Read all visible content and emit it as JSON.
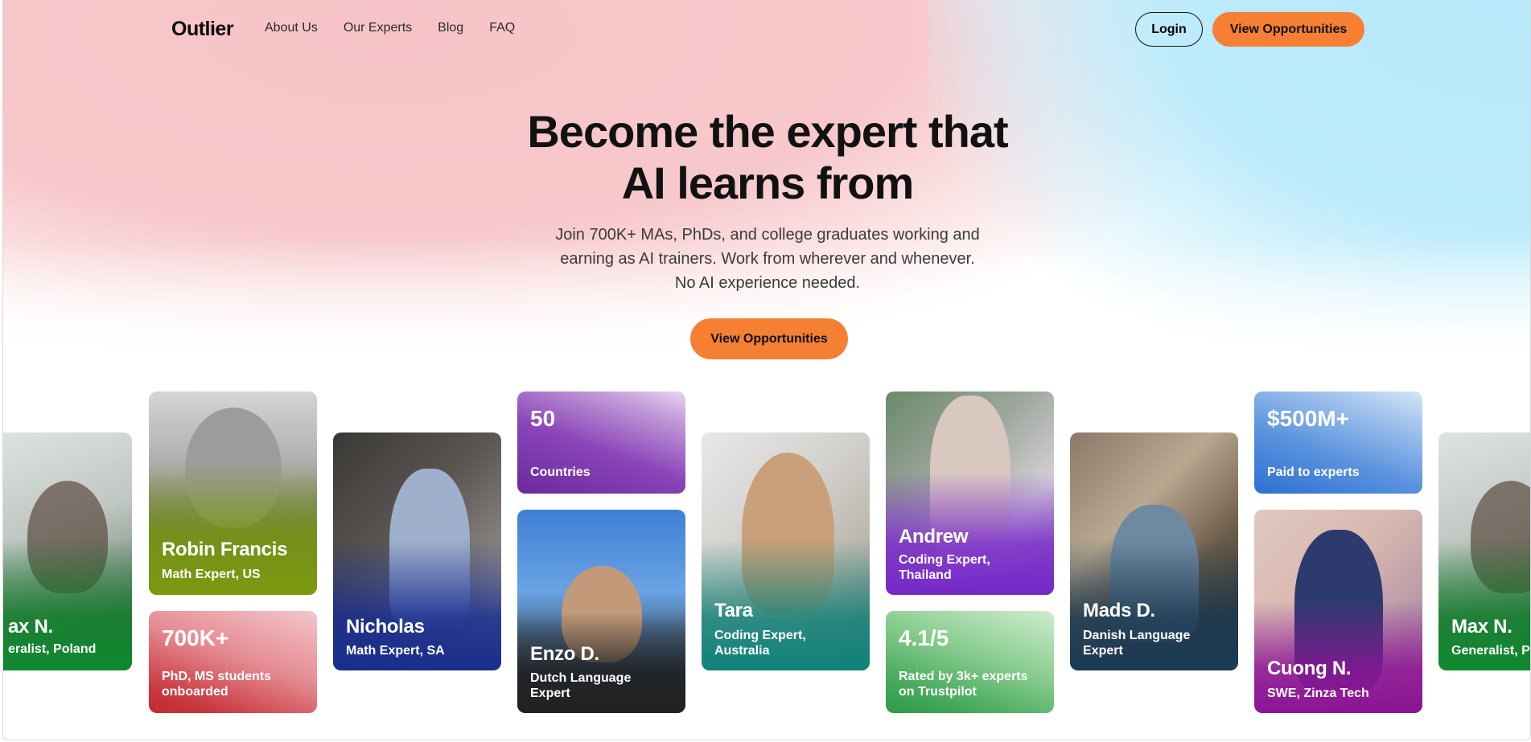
{
  "brand": {
    "logo": "Outlier",
    "accent": "#f57f33"
  },
  "nav": {
    "links": [
      "About Us",
      "Our Experts",
      "Blog",
      "FAQ"
    ],
    "login_label": "Login",
    "cta_label": "View Opportunities"
  },
  "hero": {
    "title_line1": "Become the expert that",
    "title_line2": "AI learns from",
    "subtitle_line1": "Join 700K+ MAs, PhDs, and college graduates working and",
    "subtitle_line2": "earning as AI trainers. Work from wherever and whenever.",
    "subtitle_line3": "No AI experience needed.",
    "cta_label": "View Opportunities"
  },
  "cards": {
    "maxn_left": {
      "name": "ax N.",
      "role": "eralist, Poland"
    },
    "robin": {
      "name": "Robin Francis",
      "role": "Math Expert, US"
    },
    "stat_700k": {
      "value": "700K+",
      "desc_line1": "PhD, MS students",
      "desc_line2": "onboarded"
    },
    "nicholas": {
      "name": "Nicholas",
      "role": "Math Expert, SA"
    },
    "stat_50": {
      "value": "50",
      "desc": "Countries"
    },
    "enzo": {
      "name": "Enzo D.",
      "role_line1": "Dutch Language",
      "role_line2": "Expert"
    },
    "tara": {
      "name": "Tara",
      "role_line1": "Coding Expert,",
      "role_line2": "Australia"
    },
    "andrew": {
      "name": "Andrew",
      "role_line1": "Coding Expert,",
      "role_line2": "Thailand"
    },
    "stat_41": {
      "value": "4.1/5",
      "desc_line1": "Rated by 3k+ experts",
      "desc_line2": "on Trustpilot"
    },
    "mads": {
      "name": "Mads D.",
      "role_line1": "Danish Language",
      "role_line2": "Expert"
    },
    "stat_500m": {
      "value": "$500M+",
      "desc": "Paid to experts"
    },
    "cuong": {
      "name": "Cuong N.",
      "role": "SWE, Zinza Tech"
    },
    "maxn_right": {
      "name": "Max N.",
      "role": "Generalist, P"
    }
  }
}
